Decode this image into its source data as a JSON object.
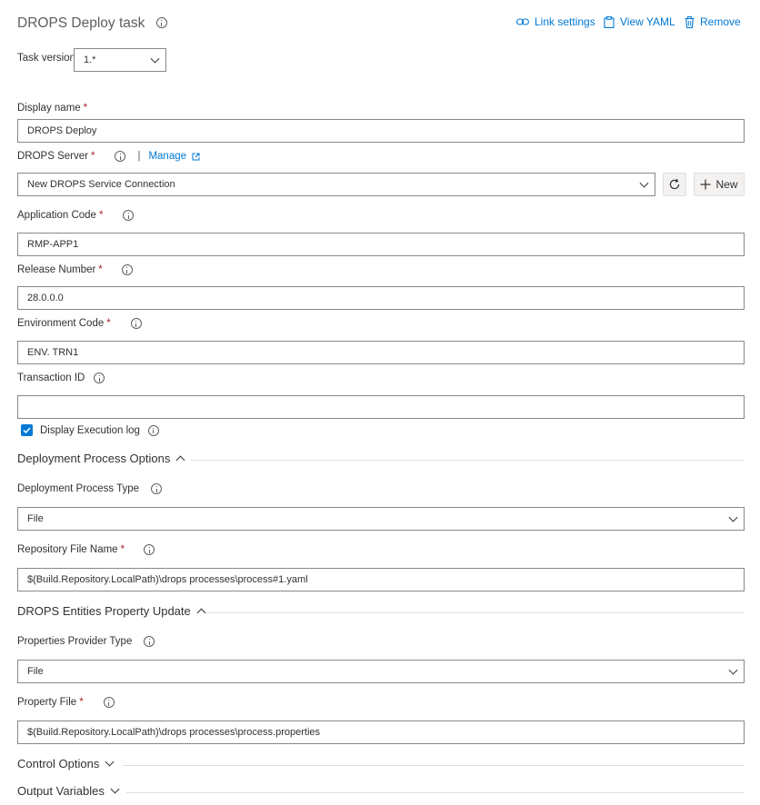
{
  "header": {
    "title": "DROPS Deploy task",
    "link_settings": "Link settings",
    "view_yaml": "View YAML",
    "remove": "Remove"
  },
  "task_version": {
    "label": "Task version",
    "value": "1.*"
  },
  "display_name": {
    "label": "Display name",
    "required": "*",
    "value": "DROPS Deploy"
  },
  "drops_server": {
    "label": "DROPS Server",
    "required": "*",
    "separator": "|",
    "manage": "Manage",
    "value": "New DROPS Service Connection",
    "new_button": "New"
  },
  "application_code": {
    "label": "Application Code",
    "required": "*",
    "value": "RMP-APP1"
  },
  "release_number": {
    "label": "Release Number",
    "required": "*",
    "value": "28.0.0.0"
  },
  "environment_code": {
    "label": "Environment Code",
    "required": "*",
    "value": "ENV. TRN1"
  },
  "transaction_id": {
    "label": "Transaction ID",
    "value": ""
  },
  "display_execution_log": {
    "label": "Display Execution log",
    "checked": true
  },
  "deployment_process_options": {
    "title": "Deployment Process Options",
    "type_label": "Deployment Process Type",
    "type_value": "File",
    "repo_label": "Repository File Name",
    "repo_required": "*",
    "repo_value": "$(Build.Repository.LocalPath)\\drops processes\\process#1.yaml"
  },
  "entities_property_update": {
    "title": "DROPS Entities Property Update",
    "provider_label": "Properties Provider Type",
    "provider_value": "File",
    "property_file_label": "Property File",
    "property_file_required": "*",
    "property_file_value": "$(Build.Repository.LocalPath)\\drops processes\\process.properties"
  },
  "control_options": {
    "title": "Control Options"
  },
  "output_variables": {
    "title": "Output Variables"
  },
  "colors": {
    "accent": "#0078d4",
    "required": "#a4262c",
    "border": "#8a8886"
  }
}
